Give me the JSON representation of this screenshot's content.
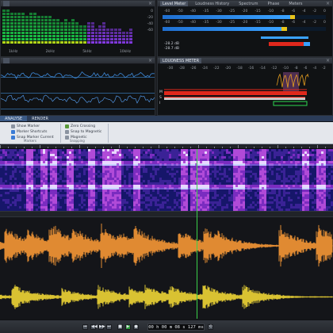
{
  "spectrum_panel": {
    "scale": [
      "0",
      "-20",
      "-40",
      "-60"
    ],
    "freq_labels": [
      "1kHz",
      "2kHz",
      "5kHz",
      "10kHz"
    ],
    "close": "×"
  },
  "level_panel": {
    "tabs": [
      "Level Meter",
      "Loudness History",
      "Spectrum",
      "Phase",
      "Meters"
    ],
    "scale": [
      "-60",
      "-50",
      "-40",
      "-35",
      "-30",
      "-25",
      "-20",
      "-15",
      "-10",
      "-8",
      "-6",
      "-4",
      "-2",
      "0"
    ],
    "readout1": "-28.2 dB",
    "readout2": "-28.7 dB",
    "close": "×"
  },
  "history_panel": {
    "close": "×"
  },
  "loudness_panel": {
    "title": "LOUDNESS METER",
    "scale": [
      "-30",
      "-28",
      "-26",
      "-24",
      "-22",
      "-20",
      "-18",
      "-16",
      "-14",
      "-12",
      "-10",
      "-8",
      "-6",
      "-4",
      "-2"
    ],
    "row_labels": [
      "M",
      "S",
      "I"
    ],
    "close": "×"
  },
  "ribbon": {
    "tabs": [
      "ANALYSE",
      "RENDER"
    ],
    "group1": [
      "Show Marker",
      "Marker Shortcuts",
      "Snap Marker Current"
    ],
    "group1_title": "Markers",
    "group2": [
      "Zero Crossing",
      "Snap to Magnetic",
      "Magnetic"
    ],
    "group2_title": "Snapping"
  },
  "transport": {
    "time": "00 h 00 m 08 s 127 ms",
    "buttons": [
      "⏮",
      "◀◀",
      "▶▶",
      "⏭",
      "■",
      "▶",
      "●",
      "⟲"
    ]
  },
  "colors": {
    "spectrum_low": "#1cd24a",
    "spectrum_mid": "#b8e01a",
    "spectrum_violet": "#8b3cf0",
    "meter_blue": "#3aa2ff",
    "meter_red": "#e0281c",
    "meter_yellow": "#e8c41a",
    "wave_orange": "#e08a32",
    "wave_yellow": "#d9c232",
    "playhead": "#3bd14a"
  }
}
